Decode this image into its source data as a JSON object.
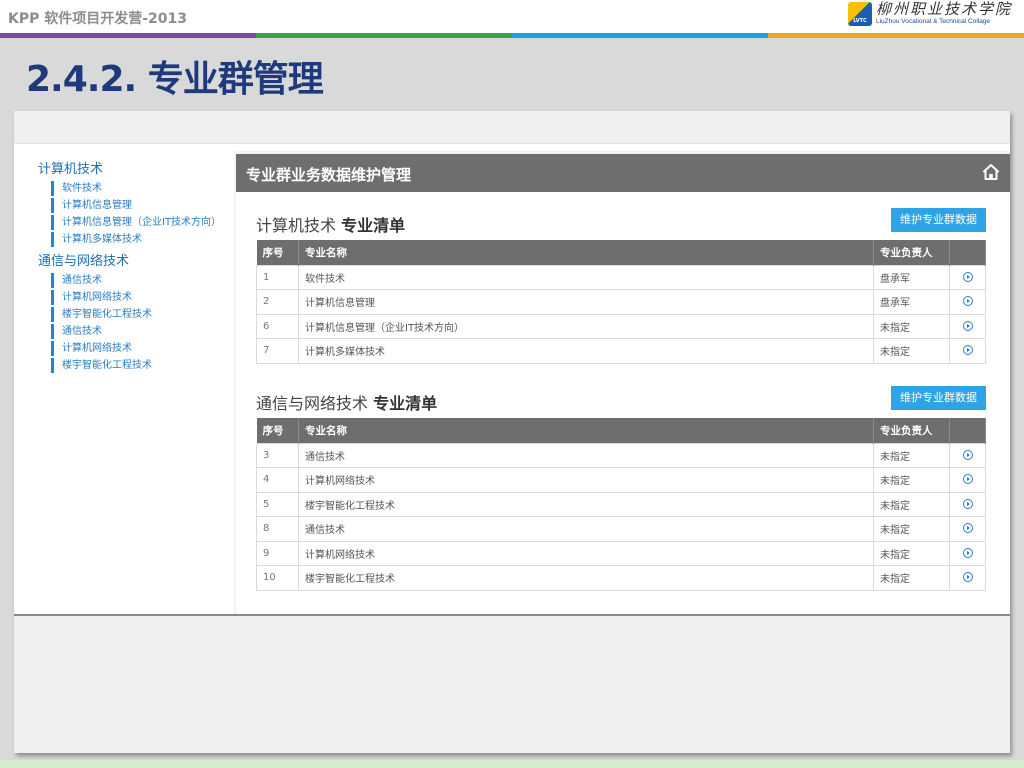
{
  "slide": {
    "header_title": "KPP 软件项目开发营-2013",
    "logo_cn": "柳州职业技术学院",
    "logo_en": "LiuZhou Vocational & Technical Collage",
    "logo_badge": "LVTC",
    "heading": "2.4.2. 专业群管理",
    "color_bar": [
      "#7b4aa8",
      "#39a54a",
      "#1ba1e2",
      "#f0a42c"
    ]
  },
  "sidebar": {
    "groups": [
      {
        "title": "计算机技术",
        "items": [
          "软件技术",
          "计算机信息管理",
          "计算机信息管理（企业IT技术方向）",
          "计算机多媒体技术"
        ]
      },
      {
        "title": "通信与网络技术",
        "items": [
          "通信技术",
          "计算机网络技术",
          "楼宇智能化工程技术",
          "通信技术",
          "计算机网络技术",
          "楼宇智能化工程技术"
        ]
      }
    ]
  },
  "panel": {
    "title": "专业群业务数据维护管理",
    "home_icon": "home-icon"
  },
  "table_headers": {
    "no": "序号",
    "name": "专业名称",
    "owner": "专业负责人"
  },
  "sections": [
    {
      "group_name": "计算机技术",
      "list_suffix": "专业清单",
      "button": "维护专业群数据",
      "rows": [
        {
          "no": "1",
          "name": "软件技术",
          "owner": "盘承军"
        },
        {
          "no": "2",
          "name": "计算机信息管理",
          "owner": "盘承军"
        },
        {
          "no": "6",
          "name": "计算机信息管理（企业IT技术方向）",
          "owner": "未指定"
        },
        {
          "no": "7",
          "name": "计算机多媒体技术",
          "owner": "未指定"
        }
      ]
    },
    {
      "group_name": "通信与网络技术",
      "list_suffix": "专业清单",
      "button": "维护专业群数据",
      "rows": [
        {
          "no": "3",
          "name": "通信技术",
          "owner": "未指定"
        },
        {
          "no": "4",
          "name": "计算机网络技术",
          "owner": "未指定"
        },
        {
          "no": "5",
          "name": "楼宇智能化工程技术",
          "owner": "未指定"
        },
        {
          "no": "8",
          "name": "通信技术",
          "owner": "未指定"
        },
        {
          "no": "9",
          "name": "计算机网络技术",
          "owner": "未指定"
        },
        {
          "no": "10",
          "name": "楼宇智能化工程技术",
          "owner": "未指定"
        }
      ]
    }
  ],
  "colors": {
    "accent_blue": "#2ea3e6",
    "header_gray": "#6e6e6e",
    "heading_blue": "#1f3a7a",
    "link_blue": "#1f6fb5"
  }
}
